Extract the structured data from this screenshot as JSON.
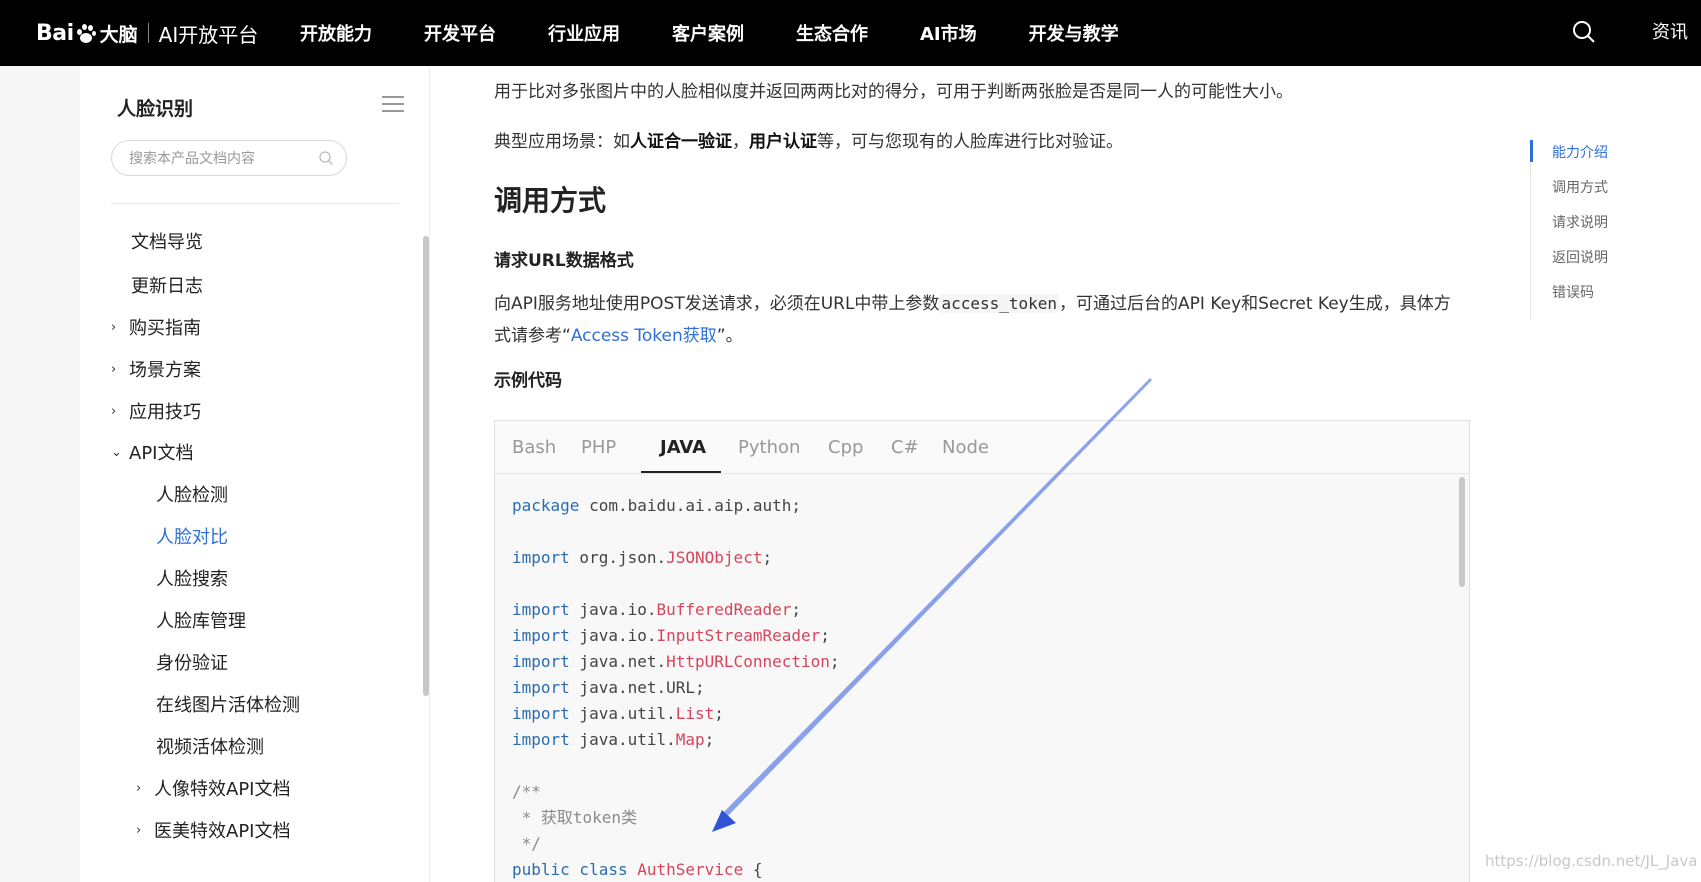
{
  "header": {
    "logo_baidu_left": "Bai",
    "logo_baidu_right": "大脑",
    "logo_platform": "AI开放平台",
    "nav": [
      "开放能力",
      "开发平台",
      "行业应用",
      "客户案例",
      "生态合作",
      "AI市场",
      "开发与教学"
    ],
    "news": "资讯",
    "search_icon": "search-icon"
  },
  "sidebar": {
    "title": "人脸识别",
    "search_placeholder": "搜索本产品文档内容",
    "items": [
      {
        "label": "文档导览",
        "arrow": ""
      },
      {
        "label": "更新日志",
        "arrow": ""
      },
      {
        "label": "购买指南",
        "arrow": "›"
      },
      {
        "label": "场景方案",
        "arrow": "›"
      },
      {
        "label": "应用技巧",
        "arrow": "›"
      },
      {
        "label": "API文档",
        "arrow": "⌄"
      },
      {
        "label": "人脸检测",
        "arrow": ""
      },
      {
        "label": "人脸对比",
        "arrow": "",
        "active": true
      },
      {
        "label": "人脸搜索",
        "arrow": ""
      },
      {
        "label": "人脸库管理",
        "arrow": ""
      },
      {
        "label": "身份验证",
        "arrow": ""
      },
      {
        "label": "在线图片活体检测",
        "arrow": ""
      },
      {
        "label": "视频活体检测",
        "arrow": ""
      },
      {
        "label": "人像特效API文档",
        "arrow": "›"
      },
      {
        "label": "医美特效API文档",
        "arrow": "›"
      }
    ]
  },
  "content": {
    "intro": "用于比对多张图片中的人脸相似度并返回两两比对的得分，可用于判断两张脸是否是同一人的可能性大小。",
    "scenario_prefix": "典型应用场景：如",
    "scenario_b1": "人证合一验证",
    "scenario_sep": "，",
    "scenario_b2": "用户认证",
    "scenario_suffix": "等，可与您现有的人脸库进行比对验证。",
    "h_call": "调用方式",
    "h_url": "请求URL数据格式",
    "req_line1_a": "向API服务地址使用POST发送请求，必须在URL中带上参数",
    "req_param": "access_token",
    "req_line1_b": "，可通过后台的API Key和Secret Key生成，具体方",
    "req_line2_a": "式请参考“",
    "req_link": "Access Token获取",
    "req_line2_b": "”。",
    "h_sample": "示例代码",
    "tabs": [
      "Bash",
      "PHP",
      "JAVA",
      "Python",
      "Cpp",
      "C#",
      "Node"
    ],
    "active_tab": "JAVA"
  },
  "code": {
    "pkg_kw": "package",
    "pkg": " com.baidu.ai.aip.auth;",
    "imp": "import",
    "l1_pre": " org.json.",
    "l1_cls": "JSONObject",
    "l1_end": ";",
    "l2_pre": " java.io.",
    "l2_cls": "BufferedReader",
    "l2_end": ";",
    "l3_pre": " java.io.",
    "l3_cls": "InputStreamReader",
    "l3_end": ";",
    "l4_pre": " java.net.",
    "l4_cls": "HttpURLConnection",
    "l4_end": ";",
    "l5_pre": " java.net.URL;",
    "l6_pre": " java.util.",
    "l6_cls": "List",
    "l6_end": ";",
    "l7_pre": " java.util.",
    "l7_cls": "Map",
    "l7_end": ";",
    "c1": "/**",
    "c2": " * 获取token类",
    "c3": " */",
    "pub": "public class",
    "svc": "AuthService",
    "brace": " {"
  },
  "toc": [
    "能力介绍",
    "调用方式",
    "请求说明",
    "返回说明",
    "错误码"
  ],
  "watermark": "https://blog.csdn.net/JL_Java",
  "colors": {
    "accent": "#2f6fd8",
    "annotation_arrow": "#2f55d4",
    "keyword": "#2b6cb0",
    "class": "#d6455b"
  }
}
